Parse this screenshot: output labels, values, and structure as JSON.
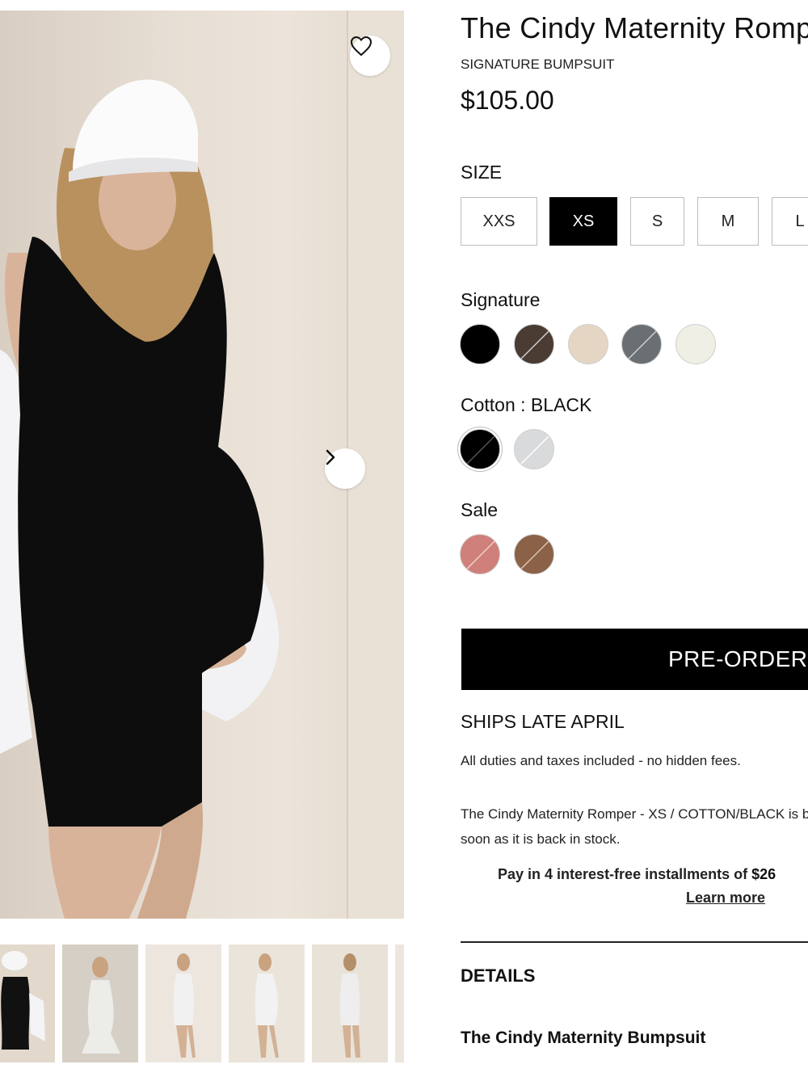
{
  "product": {
    "title": "The Cindy Maternity Romp",
    "subtitle": "SIGNATURE BUMPSUIT",
    "price": "$105.00"
  },
  "size": {
    "label": "SIZE",
    "options": [
      "XXS",
      "XS",
      "S",
      "M",
      "L"
    ],
    "selected": "XS"
  },
  "colors": {
    "signature_label": "Signature",
    "signature": [
      {
        "name": "black",
        "hex": "#000000",
        "available": true
      },
      {
        "name": "brown",
        "hex": "#4a3b33",
        "available": false
      },
      {
        "name": "beige",
        "hex": "#e4d6c3",
        "available": true
      },
      {
        "name": "grey",
        "hex": "#6a6f73",
        "available": false
      },
      {
        "name": "ivory",
        "hex": "#efefe6",
        "available": true
      }
    ],
    "cotton_label": "Cotton : BLACK",
    "cotton": [
      {
        "name": "black",
        "hex": "#000000",
        "available": false
      },
      {
        "name": "light-grey",
        "hex": "#d9dadb",
        "available": false
      }
    ],
    "sale_label": "Sale",
    "sale": [
      {
        "name": "rose",
        "hex": "#cf807a",
        "available": false
      },
      {
        "name": "mocha",
        "hex": "#8b6247",
        "available": false
      }
    ]
  },
  "actions": {
    "preorder_label": "PRE-ORDER"
  },
  "shipping": {
    "ships": "SHIPS LATE APRIL",
    "duties": "All duties and taxes included - no hidden fees.",
    "notify_line1": "The Cindy Maternity Romper - XS / COTTON/BLACK is b",
    "notify_line2": "soon as it is back in stock."
  },
  "payment": {
    "installments_text": "Pay in 4 interest-free installments of ",
    "installments_amount": "$26",
    "learn_more": "Learn more"
  },
  "details": {
    "heading": "DETAILS",
    "subheading": "The Cindy Maternity Bumpsuit"
  },
  "gallery": {
    "thumbnail_count": 6
  }
}
